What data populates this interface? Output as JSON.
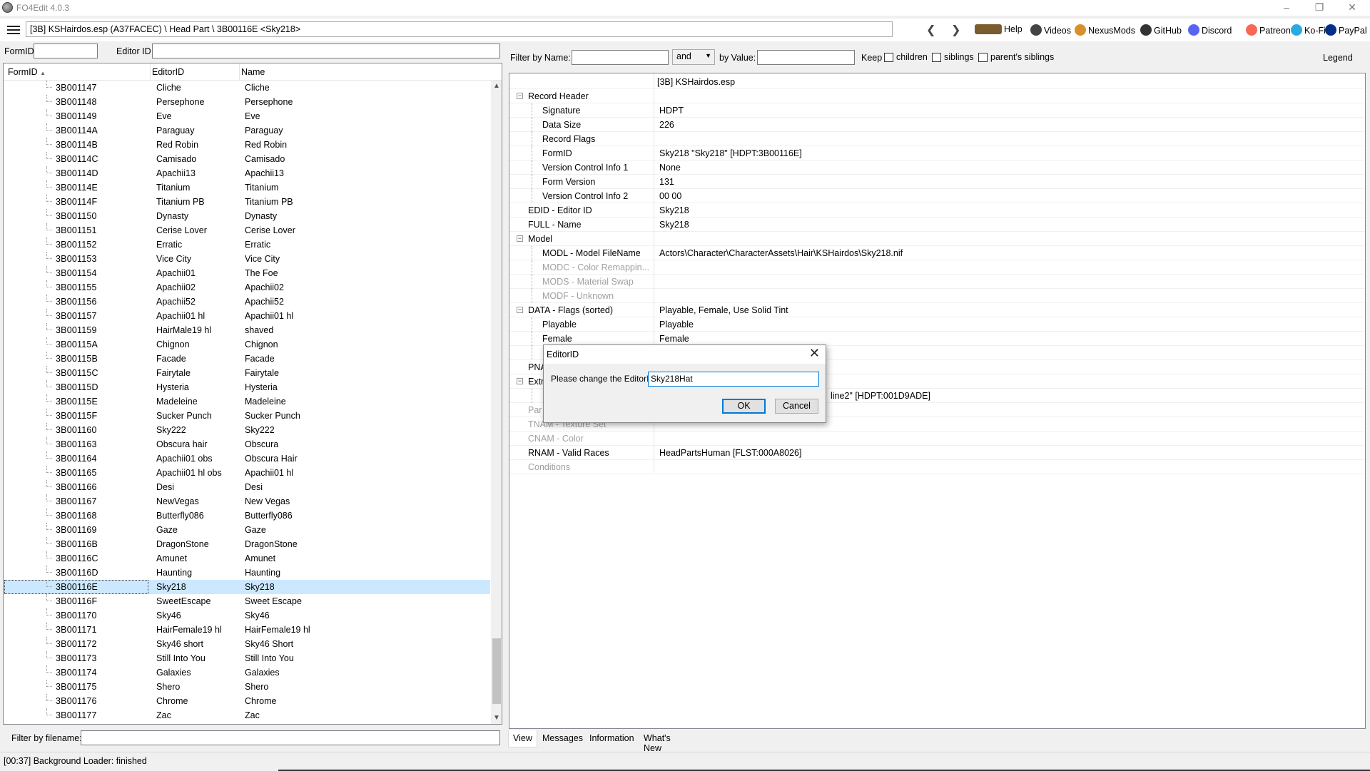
{
  "window": {
    "title": "FO4Edit 4.0.3"
  },
  "toolbar": {
    "path": "[3B] KSHairdos.esp (A37FACEC) \\ Head Part \\ 3B00116E <Sky218>",
    "links": [
      {
        "label": "Help",
        "icon": "book-icon",
        "color": "#7a5c2e"
      },
      {
        "label": "Videos",
        "icon": "film-icon",
        "color": "#444444"
      },
      {
        "label": "NexusMods",
        "icon": "nexus-icon",
        "color": "#d98f2b"
      },
      {
        "label": "GitHub",
        "icon": "github-icon",
        "color": "#333333"
      },
      {
        "label": "Discord",
        "icon": "discord-icon",
        "color": "#5865f2"
      },
      {
        "label": "Patreon",
        "icon": "patreon-icon",
        "color": "#f96854"
      },
      {
        "label": "Ko-Fi",
        "icon": "kofi-icon",
        "color": "#29abe0"
      },
      {
        "label": "PayPal",
        "icon": "paypal-icon",
        "color": "#003087"
      }
    ]
  },
  "left": {
    "formid_label": "FormID",
    "editorid_label": "Editor ID",
    "columns": {
      "formid": "FormID",
      "editorid": "EditorID",
      "name": "Name"
    },
    "rows": [
      {
        "id": "3B001147",
        "edid": "Cliche",
        "name": "Cliche"
      },
      {
        "id": "3B001148",
        "edid": "Persephone",
        "name": "Persephone"
      },
      {
        "id": "3B001149",
        "edid": "Eve",
        "name": "Eve"
      },
      {
        "id": "3B00114A",
        "edid": "Paraguay",
        "name": "Paraguay"
      },
      {
        "id": "3B00114B",
        "edid": "Red Robin",
        "name": "Red Robin"
      },
      {
        "id": "3B00114C",
        "edid": "Camisado",
        "name": "Camisado"
      },
      {
        "id": "3B00114D",
        "edid": "Apachii13",
        "name": "Apachii13"
      },
      {
        "id": "3B00114E",
        "edid": "Titanium",
        "name": "Titanium"
      },
      {
        "id": "3B00114F",
        "edid": "Titanium PB",
        "name": "Titanium PB"
      },
      {
        "id": "3B001150",
        "edid": "Dynasty",
        "name": "Dynasty"
      },
      {
        "id": "3B001151",
        "edid": "Cerise Lover",
        "name": "Cerise Lover"
      },
      {
        "id": "3B001152",
        "edid": "Erratic",
        "name": "Erratic"
      },
      {
        "id": "3B001153",
        "edid": "Vice City",
        "name": "Vice City"
      },
      {
        "id": "3B001154",
        "edid": "Apachii01",
        "name": "The Foe"
      },
      {
        "id": "3B001155",
        "edid": "Apachii02",
        "name": "Apachii02"
      },
      {
        "id": "3B001156",
        "edid": "Apachii52",
        "name": "Apachii52"
      },
      {
        "id": "3B001157",
        "edid": "Apachii01 hl",
        "name": "Apachii01 hl"
      },
      {
        "id": "3B001159",
        "edid": "HairMale19 hl",
        "name": "shaved"
      },
      {
        "id": "3B00115A",
        "edid": "Chignon",
        "name": "Chignon"
      },
      {
        "id": "3B00115B",
        "edid": "Facade",
        "name": "Facade"
      },
      {
        "id": "3B00115C",
        "edid": "Fairytale",
        "name": "Fairytale"
      },
      {
        "id": "3B00115D",
        "edid": "Hysteria",
        "name": "Hysteria"
      },
      {
        "id": "3B00115E",
        "edid": "Madeleine",
        "name": "Madeleine"
      },
      {
        "id": "3B00115F",
        "edid": "Sucker Punch",
        "name": "Sucker Punch"
      },
      {
        "id": "3B001160",
        "edid": "Sky222",
        "name": "Sky222"
      },
      {
        "id": "3B001163",
        "edid": "Obscura hair",
        "name": "Obscura"
      },
      {
        "id": "3B001164",
        "edid": "Apachii01 obs",
        "name": "Obscura Hair"
      },
      {
        "id": "3B001165",
        "edid": "Apachii01 hl obs",
        "name": "Apachii01 hl"
      },
      {
        "id": "3B001166",
        "edid": "Desi",
        "name": "Desi"
      },
      {
        "id": "3B001167",
        "edid": "NewVegas",
        "name": "New Vegas"
      },
      {
        "id": "3B001168",
        "edid": "Butterfly086",
        "name": "Butterfly086"
      },
      {
        "id": "3B001169",
        "edid": "Gaze",
        "name": "Gaze"
      },
      {
        "id": "3B00116B",
        "edid": "DragonStone",
        "name": "DragonStone"
      },
      {
        "id": "3B00116C",
        "edid": "Amunet",
        "name": "Amunet"
      },
      {
        "id": "3B00116D",
        "edid": "Haunting",
        "name": "Haunting"
      },
      {
        "id": "3B00116E",
        "edid": "Sky218",
        "name": "Sky218",
        "selected": true
      },
      {
        "id": "3B00116F",
        "edid": "SweetEscape",
        "name": "Sweet Escape"
      },
      {
        "id": "3B001170",
        "edid": "Sky46",
        "name": "Sky46"
      },
      {
        "id": "3B001171",
        "edid": "HairFemale19 hl",
        "name": "HairFemale19 hl"
      },
      {
        "id": "3B001172",
        "edid": "Sky46 short",
        "name": "Sky46 Short"
      },
      {
        "id": "3B001173",
        "edid": "Still Into You",
        "name": "Still Into You"
      },
      {
        "id": "3B001174",
        "edid": "Galaxies",
        "name": "Galaxies"
      },
      {
        "id": "3B001175",
        "edid": "Shero",
        "name": "Shero"
      },
      {
        "id": "3B001176",
        "edid": "Chrome",
        "name": "Chrome"
      },
      {
        "id": "3B001177",
        "edid": "Zac",
        "name": "Zac"
      }
    ],
    "filter_label": "Filter by filename:"
  },
  "right": {
    "filter_name_label": "Filter by Name:",
    "and_value": "and",
    "by_value_label": "by Value:",
    "keep_label": "Keep",
    "children_label": "children",
    "siblings_label": "siblings",
    "parents_siblings_label": "parent's siblings",
    "legend_label": "Legend",
    "file_header": "[3B] KSHairdos.esp",
    "rows": [
      {
        "key": "Record Header",
        "value": "",
        "level": 0,
        "expander": "−"
      },
      {
        "key": "Signature",
        "value": "HDPT",
        "level": 1
      },
      {
        "key": "Data Size",
        "value": "226",
        "level": 1
      },
      {
        "key": "Record Flags",
        "value": "",
        "level": 1
      },
      {
        "key": "FormID",
        "value": "Sky218 \"Sky218\" [HDPT:3B00116E]",
        "level": 1
      },
      {
        "key": "Version Control Info 1",
        "value": "None",
        "level": 1
      },
      {
        "key": "Form Version",
        "value": "131",
        "level": 1
      },
      {
        "key": "Version Control Info 2",
        "value": "00 00",
        "level": 1
      },
      {
        "key": "EDID - Editor ID",
        "value": "Sky218",
        "level": 0
      },
      {
        "key": "FULL - Name",
        "value": "Sky218",
        "level": 0
      },
      {
        "key": "Model",
        "value": "",
        "level": 0,
        "expander": "−"
      },
      {
        "key": "MODL - Model FileName",
        "value": "Actors\\Character\\CharacterAssets\\Hair\\KSHairdos\\Sky218.nif",
        "level": 1
      },
      {
        "key": "MODC - Color Remappin...",
        "value": "",
        "level": 1,
        "disabled": true
      },
      {
        "key": "MODS - Material Swap",
        "value": "",
        "level": 1,
        "disabled": true
      },
      {
        "key": "MODF - Unknown",
        "value": "",
        "level": 1,
        "disabled": true
      },
      {
        "key": "DATA - Flags (sorted)",
        "value": "Playable, Female, Use Solid Tint",
        "level": 0,
        "expander": "−"
      },
      {
        "key": "Playable",
        "value": "Playable",
        "level": 1
      },
      {
        "key": "Female",
        "value": "Female",
        "level": 1
      },
      {
        "key": "",
        "value": "",
        "level": 1
      },
      {
        "key": "PNA",
        "value": "",
        "level": 0
      },
      {
        "key": "Extr",
        "value": "",
        "level": 0,
        "expander": "−"
      },
      {
        "key": "",
        "value": "line2\" [HDPT:001D9ADE]",
        "level": 1,
        "valueOffset": 240
      },
      {
        "key": "Par",
        "value": "",
        "level": 0,
        "disabled": true
      },
      {
        "key": "TNAM - Texture Set",
        "value": "",
        "level": 0,
        "disabled": true
      },
      {
        "key": "CNAM - Color",
        "value": "",
        "level": 0,
        "disabled": true
      },
      {
        "key": "RNAM - Valid Races",
        "value": "HeadPartsHuman [FLST:000A8026]",
        "level": 0
      },
      {
        "key": "Conditions",
        "value": "",
        "level": 0,
        "disabled": true
      }
    ]
  },
  "tabs": [
    "View",
    "Messages",
    "Information",
    "What's New"
  ],
  "status": "[00:37] Background Loader: finished",
  "dialog": {
    "title": "EditorID",
    "prompt": "Please change the EditorID",
    "value": "Sky218Hat",
    "ok": "OK",
    "cancel": "Cancel"
  }
}
